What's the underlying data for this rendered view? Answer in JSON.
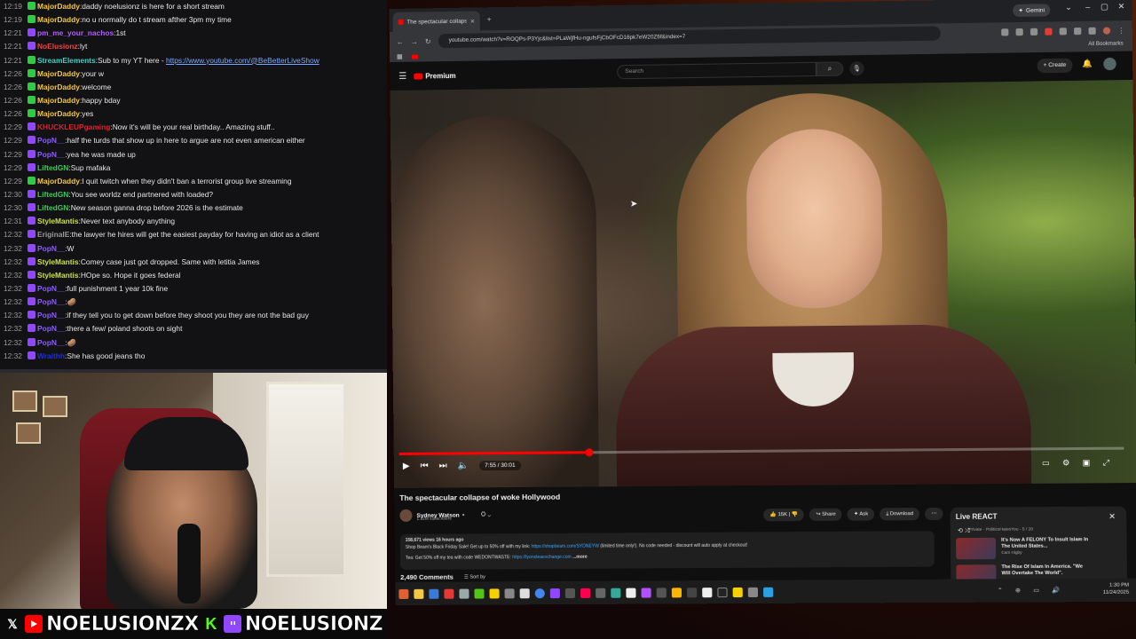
{
  "chat": {
    "messages": [
      {
        "time": "12:19",
        "user": "MajorDaddy",
        "color": "#f2c744",
        "badge": "#2ecc40",
        "text": "daddy noelusionz is here for a short stream"
      },
      {
        "time": "12:19",
        "user": "MajorDaddy",
        "color": "#f2c744",
        "badge": "#2ecc40",
        "text": "no u normally do t stream afther 3pm my time"
      },
      {
        "time": "12:21",
        "user": "pm_me_your_nachos",
        "color": "#b35cff",
        "badge": "#9146ff",
        "text": "1st"
      },
      {
        "time": "12:21",
        "user": "NoElusionz",
        "color": "#ff3c3c",
        "badge": "#9146ff",
        "text": "lyt"
      },
      {
        "time": "12:21",
        "user": "StreamElements",
        "color": "#38d6c6",
        "badge": "#2ecc40",
        "text": "Sub to my YT here - ",
        "link": "https://www.youtube.com/@BeBetterLiveShow"
      },
      {
        "time": "12:26",
        "user": "MajorDaddy",
        "color": "#f2c744",
        "badge": "#2ecc40",
        "text": "your w"
      },
      {
        "time": "12:26",
        "user": "MajorDaddy",
        "color": "#f2c744",
        "badge": "#2ecc40",
        "text": "welcome"
      },
      {
        "time": "12:26",
        "user": "MajorDaddy",
        "color": "#f2c744",
        "badge": "#2ecc40",
        "text": "happy bday"
      },
      {
        "time": "12:26",
        "user": "MajorDaddy",
        "color": "#f2c744",
        "badge": "#2ecc40",
        "text": "yes"
      },
      {
        "time": "12:29",
        "user": "KHUCKLEUPgaming",
        "color": "#e0202a",
        "badge": "#9146ff",
        "text": "Now it's will be your real birthday.. Amazing stuff.."
      },
      {
        "time": "12:29",
        "user": "PopN__",
        "color": "#8a5cff",
        "badge": "#9146ff",
        "text": "half the turds that show up in here to argue are not even american either"
      },
      {
        "time": "12:29",
        "user": "PopN__",
        "color": "#8a5cff",
        "badge": "#9146ff",
        "text": "yea he was made up"
      },
      {
        "time": "12:29",
        "user": "LiftedGN",
        "color": "#3cc85a",
        "badge": "#9146ff",
        "text": "Sup mafaka"
      },
      {
        "time": "12:29",
        "user": "MajorDaddy",
        "color": "#f2c744",
        "badge": "#2ecc40",
        "text": "I quit twitch when they didn't ban a terrorist group live streaming"
      },
      {
        "time": "12:30",
        "user": "LiftedGN",
        "color": "#3cc85a",
        "badge": "#9146ff",
        "text": "You see worldz end partnered with loaded?"
      },
      {
        "time": "12:30",
        "user": "LiftedGN",
        "color": "#3cc85a",
        "badge": "#9146ff",
        "text": "New season ganna drop before 2026 is the estimate"
      },
      {
        "time": "12:31",
        "user": "StyleMantis",
        "color": "#c8e050",
        "badge": "#9146ff",
        "text": "Never text anybody anything"
      },
      {
        "time": "12:32",
        "user": "EriginalE",
        "color": "#9a9a9a",
        "badge": "#9146ff",
        "text": "the lawyer he hires will get the easiest payday for having an idiot as a client"
      },
      {
        "time": "12:32",
        "user": "PopN__",
        "color": "#8a5cff",
        "badge": "#9146ff",
        "text": "W"
      },
      {
        "time": "12:32",
        "user": "StyleMantis",
        "color": "#c8e050",
        "badge": "#9146ff",
        "text": "Comey case just got dropped. Same with letitia James"
      },
      {
        "time": "12:32",
        "user": "StyleMantis",
        "color": "#c8e050",
        "badge": "#9146ff",
        "text": "HOpe so. Hope it goes federal"
      },
      {
        "time": "12:32",
        "user": "PopN__",
        "color": "#8a5cff",
        "badge": "#9146ff",
        "text": "full punishment 1 year 10k fine"
      },
      {
        "time": "12:32",
        "user": "PopN__",
        "color": "#8a5cff",
        "badge": "#9146ff",
        "text": "🥔"
      },
      {
        "time": "12:32",
        "user": "PopN__",
        "color": "#8a5cff",
        "badge": "#9146ff",
        "text": "if they tell you to get down before they shoot you they are not the bad guy"
      },
      {
        "time": "12:32",
        "user": "PopN__",
        "color": "#8a5cff",
        "badge": "#9146ff",
        "text": "there a few/ poland shoots on sight"
      },
      {
        "time": "12:32",
        "user": "PopN__",
        "color": "#8a5cff",
        "badge": "#9146ff",
        "text": "🥔"
      },
      {
        "time": "12:32",
        "user": "Wraithh",
        "color": "#2030d0",
        "badge": "#9146ff",
        "text": "She has good jeans tho"
      }
    ]
  },
  "social": {
    "youtube_handle": "NOELUSIONZX",
    "twitch_handle": "NOELUSIONZ",
    "x_icon": "x-icon",
    "kick_icon": "kick-icon"
  },
  "browser": {
    "tab_title": "The spectacular collapse of woke",
    "gemini_label": "Gemini",
    "url": "youtube.com/watch?v=ROQPs-P3Yjc&list=PLaWjfHu-ngufsFjCbOFcD16pk7eW20Z6f&index=7",
    "all_bookmarks": "All Bookmarks"
  },
  "youtube": {
    "logo_text": "Premium",
    "search_placeholder": "Search",
    "create_label": "Create",
    "video": {
      "title": "The spectacular collapse of woke Hollywood",
      "timecode": "7:55 / 30:01",
      "progress_fraction": 0.264
    },
    "channel": {
      "name": "Sydney Watson",
      "subs": "1.12M subscribers"
    },
    "actions": {
      "likes": "15K",
      "share": "Share",
      "ask": "Ask",
      "download": "Download"
    },
    "description": {
      "stats": "158,671 views  16 hours ago",
      "line1_text": "Shop Beam's Black Friday Sale! Get up to 50% off with my link: ",
      "line1_link": "https://shopbeam.com/SYDNEYW",
      "line1_tail": " (limited time only!). No code needed - discount will auto apply at checkout!",
      "line2_text": "Tea: Get 50% off my tea with code WEDONTWASTE: ",
      "line2_link": "https://lyonsteaexchange.com",
      "line2_more": "...more"
    },
    "comments": {
      "count": "2,490 Comments",
      "sort": "Sort by"
    },
    "live_panel": {
      "title": "Live REACT",
      "sub": "Private · PoliticsHatesYou - 5 / 20",
      "items": [
        {
          "title": "It's Now A FELONY To Insult Islam In The United States...",
          "channel": "Cam Higby"
        },
        {
          "title": "The Rise Of Islam In America. \"We Will Overtake The World\".",
          "channel": ""
        }
      ]
    }
  },
  "taskbar": {
    "time": "1:30 PM",
    "date": "11/24/2025"
  }
}
